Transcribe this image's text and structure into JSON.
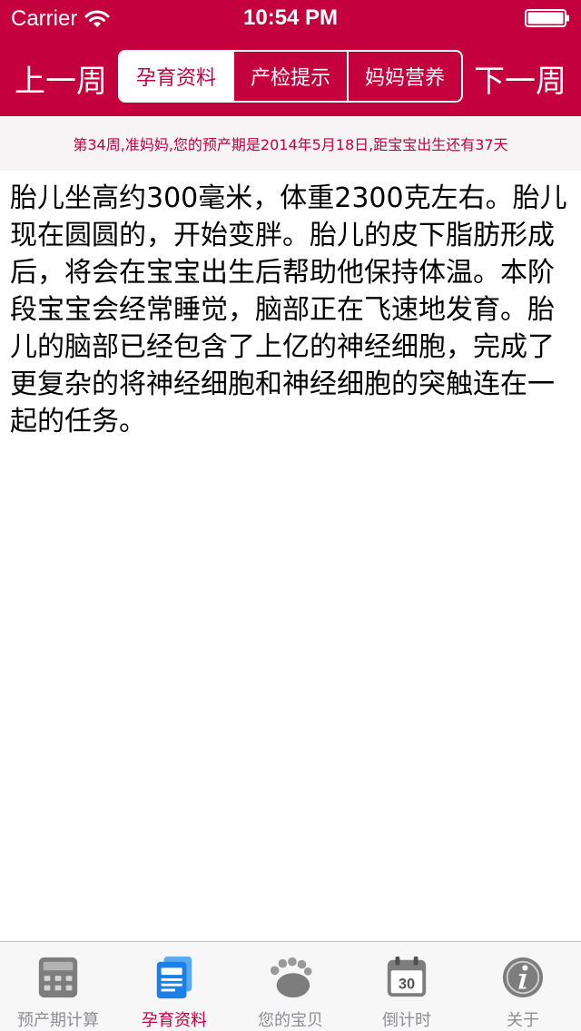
{
  "status_bar": {
    "carrier": "Carrier",
    "time": "10:54 PM"
  },
  "nav": {
    "prev_week": "上一周",
    "next_week": "下一周",
    "segments": [
      {
        "label": "孕育资料",
        "selected": true
      },
      {
        "label": "产检提示",
        "selected": false
      },
      {
        "label": "妈妈营养",
        "selected": false
      }
    ]
  },
  "banner": {
    "text": "第34周,准妈妈,您的预产期是2014年5月18日,距宝宝出生还有37天"
  },
  "content": {
    "text": "胎儿坐高约300毫米，体重2300克左右。胎儿现在圆圆的，开始变胖。胎儿的皮下脂肪形成后，将会在宝宝出生后帮助他保持体温。本阶段宝宝会经常睡觉，脑部正在飞速地发育。胎儿的脑部已经包含了上亿的神经细胞，完成了更复杂的将神经细胞和神经细胞的突触连在一起的任务。"
  },
  "tabbar": {
    "items": [
      {
        "label": "预产期计算",
        "icon": "calculator-icon",
        "active": false
      },
      {
        "label": "孕育资料",
        "icon": "document-icon",
        "active": true
      },
      {
        "label": "您的宝贝",
        "icon": "baby-foot-icon",
        "active": false
      },
      {
        "label": "倒计时",
        "icon": "calendar-icon",
        "active": false,
        "calendar_day": "30"
      },
      {
        "label": "关于",
        "icon": "info-icon",
        "active": false
      }
    ]
  },
  "colors": {
    "brand": "#c4003f",
    "banner_bg": "#f6f4f4",
    "tab_inactive": "#8e8e93",
    "tab_active_icon": "#1a7fe8"
  }
}
